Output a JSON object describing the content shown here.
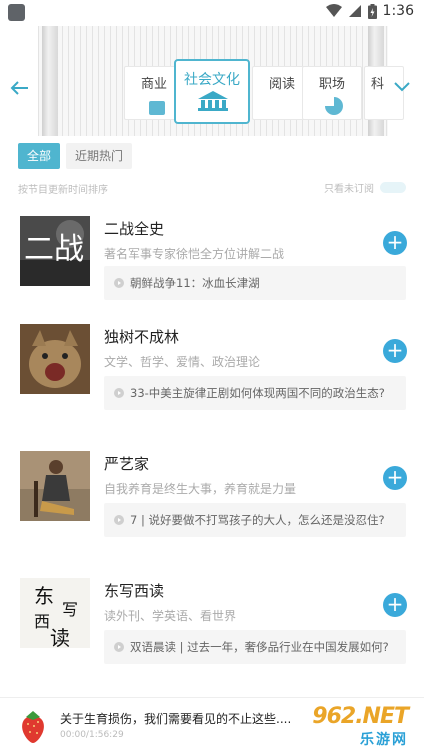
{
  "status_bar": {
    "time": "1:36"
  },
  "categories": [
    {
      "label": "商业"
    },
    {
      "label": "社会文化"
    },
    {
      "label": "阅读"
    },
    {
      "label": "职场"
    },
    {
      "label": "科"
    }
  ],
  "filter_tabs": [
    {
      "label": "全部"
    },
    {
      "label": "近期热门"
    }
  ],
  "sort_text": "按节目更新时间排序",
  "only_subscribed_label": "只看未订阅",
  "programs": [
    {
      "title": "二战全史",
      "desc": "著名军事专家徐恺全方位讲解二战",
      "latest": "朝鲜战争11：冰血长津湖",
      "cover_text": "二战"
    },
    {
      "title": "独树不成林",
      "desc": "文学、哲学、爱情、政治理论",
      "latest": "33-中美主旋律正剧如何体现两国不同的政治生态?"
    },
    {
      "title": "严艺家",
      "desc": "自我养育是终生大事，养育就是力量",
      "latest": "7 | 说好要做不打骂孩子的大人，怎么还是没忍住?"
    },
    {
      "title": "东写西读",
      "desc": "读外刊、学英语、看世界",
      "latest": "双语晨读 | 过去一年，奢侈品行业在中国发展如何?",
      "cover_chars": [
        "东",
        "写",
        "西",
        "读"
      ]
    }
  ],
  "player": {
    "title": "关于生育损伤，我们需要看见的不止这些......",
    "time": "00:00/1:56:29"
  },
  "watermark": {
    "number": "962.NET",
    "sub": "乐游网"
  },
  "colors": {
    "accent": "#4fb5cf",
    "add_button": "#3aa9da"
  }
}
